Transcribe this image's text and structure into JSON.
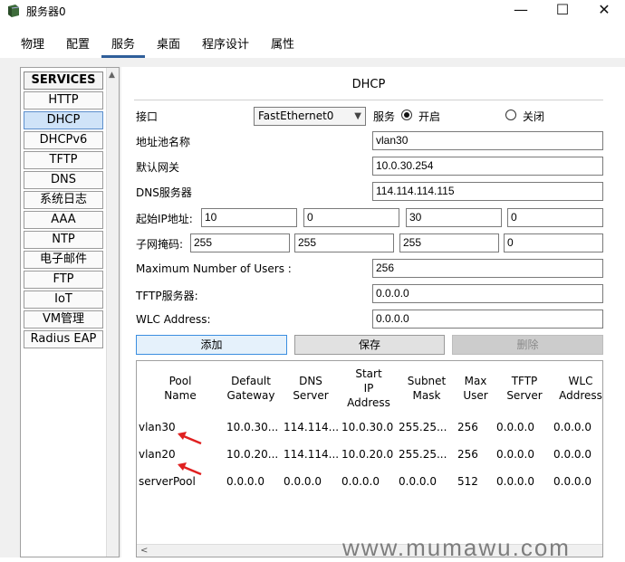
{
  "window": {
    "title": "服务器0",
    "minimize": "—",
    "maximize": "☐",
    "close": "✕"
  },
  "tabs": [
    {
      "label": "物理"
    },
    {
      "label": "配置"
    },
    {
      "label": "服务"
    },
    {
      "label": "桌面"
    },
    {
      "label": "程序设计"
    },
    {
      "label": "属性"
    }
  ],
  "sidebar": {
    "header": "SERVICES",
    "items": [
      {
        "label": "HTTP"
      },
      {
        "label": "DHCP"
      },
      {
        "label": "DHCPv6"
      },
      {
        "label": "TFTP"
      },
      {
        "label": "DNS"
      },
      {
        "label": "系统日志"
      },
      {
        "label": "AAA"
      },
      {
        "label": "NTP"
      },
      {
        "label": "电子邮件"
      },
      {
        "label": "FTP"
      },
      {
        "label": "IoT"
      },
      {
        "label": "VM管理"
      },
      {
        "label": "Radius EAP"
      }
    ]
  },
  "dhcp": {
    "title": "DHCP",
    "interface_label": "接口",
    "interface_value": "FastEthernet0",
    "service_label": "服务",
    "on_label": "开启",
    "off_label": "关闭",
    "pool_name_label": "地址池名称",
    "pool_name_value": "vlan30",
    "gateway_label": "默认网关",
    "gateway_value": "10.0.30.254",
    "dns_label": "DNS服务器",
    "dns_value": "114.114.114.115",
    "start_ip_label": "起始IP地址:",
    "start_ip": [
      "10",
      "0",
      "30",
      "0"
    ],
    "mask_label": "子网掩码:",
    "mask": [
      "255",
      "255",
      "255",
      "0"
    ],
    "max_users_label": "Maximum Number of Users :",
    "max_users_value": "256",
    "tftp_label": "TFTP服务器:",
    "tftp_value": "0.0.0.0",
    "wlc_label": "WLC Address:",
    "wlc_value": "0.0.0.0",
    "add_button": "添加",
    "save_button": "保存",
    "delete_button": "删除"
  },
  "table": {
    "headers": [
      [
        "Pool",
        "Name"
      ],
      [
        "Default",
        "Gateway"
      ],
      [
        "DNS",
        "Server"
      ],
      [
        "Start",
        "IP",
        "Address"
      ],
      [
        "Subnet",
        "Mask"
      ],
      [
        "Max",
        "User"
      ],
      [
        "TFTP",
        "Server"
      ],
      [
        "WLC",
        "Address"
      ]
    ],
    "rows": [
      [
        "vlan30",
        "10.0.30...",
        "114.114...",
        "10.0.30.0",
        "255.25...",
        "256",
        "0.0.0.0",
        "0.0.0.0"
      ],
      [
        "vlan20",
        "10.0.20...",
        "114.114...",
        "10.0.20.0",
        "255.25...",
        "256",
        "0.0.0.0",
        "0.0.0.0"
      ],
      [
        "serverPool",
        "0.0.0.0",
        "0.0.0.0",
        "0.0.0.0",
        "0.0.0.0",
        "512",
        "0.0.0.0",
        "0.0.0.0"
      ]
    ]
  },
  "annotation_color": "#e02020",
  "accent_color": "#2f5e9a",
  "watermark": "www.mumawu.com"
}
